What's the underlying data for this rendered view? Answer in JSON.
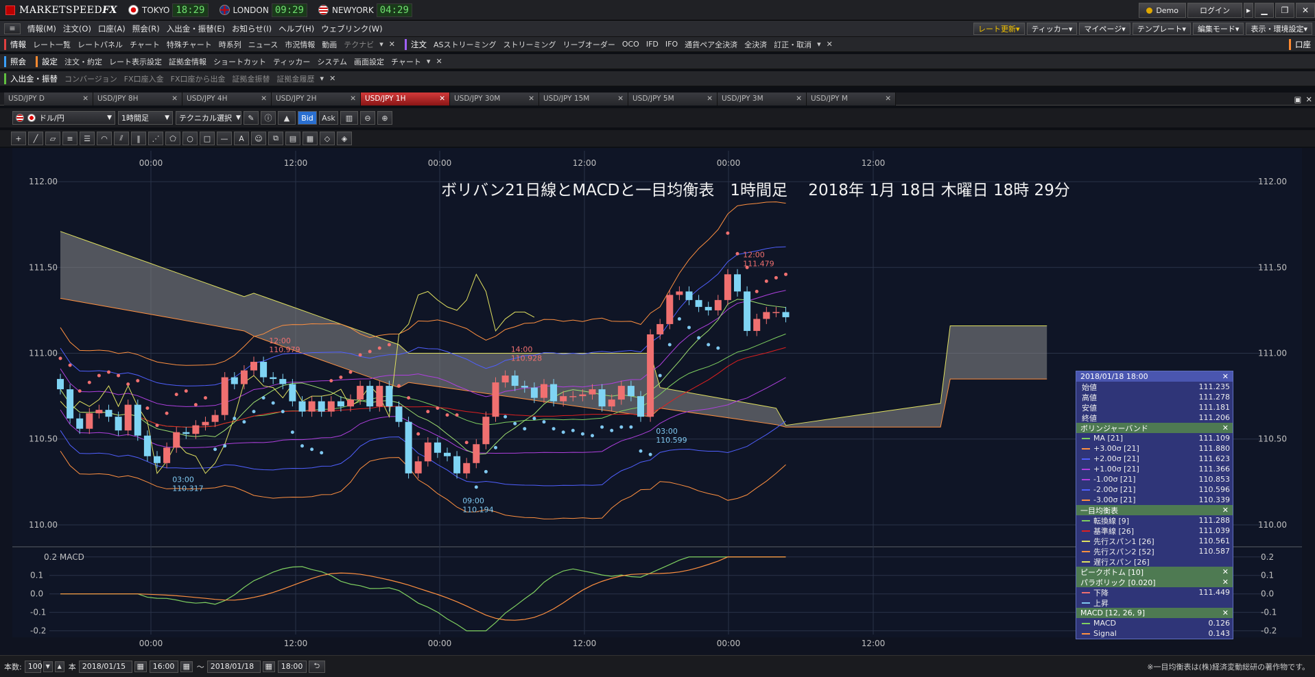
{
  "app": {
    "name_main": "MARKETSPEED",
    "name_suffix": " FX"
  },
  "clocks": [
    {
      "city": "TOKYO",
      "time": "18:29",
      "flag": "jp"
    },
    {
      "city": "LONDON",
      "time": "09:29",
      "flag": "uk"
    },
    {
      "city": "NEWYORK",
      "time": "04:29",
      "flag": "us"
    }
  ],
  "titlebar": {
    "demo": "Demo",
    "login": "ログイン"
  },
  "menu": [
    "情報(M)",
    "注文(O)",
    "口座(A)",
    "照会(R)",
    "入出金・振替(E)",
    "お知らせ(I)",
    "ヘルプ(H)",
    "ウェブリンク(W)"
  ],
  "menu_right": [
    "レート更新▾",
    "ティッカー▾",
    "マイページ▾",
    "テンプレート▾",
    "編集モード▾",
    "表示・環境設定▾"
  ],
  "strip1": {
    "sect_info": "情報",
    "info_items": [
      "レート一覧",
      "レートパネル",
      "チャート",
      "特殊チャート",
      "時系列",
      "ニュース",
      "市況情報",
      "動画",
      "テクナビ"
    ],
    "sect_order": "注文",
    "order_items": [
      "ASストリーミング",
      "ストリーミング",
      "リーブオーダー",
      "OCO",
      "IFD",
      "IFO",
      "通貨ペア全決済",
      "全決済",
      "訂正・取消"
    ],
    "account": "口座"
  },
  "strip2": {
    "sect_query": "照会",
    "sect_settings": "設定",
    "settings_items": [
      "注文・約定",
      "レート表示設定",
      "証拠金情報",
      "ショートカット",
      "ティッカー",
      "システム",
      "画面設定",
      "チャート"
    ]
  },
  "strip3": {
    "sect": "入出金・振替",
    "items": [
      "コンバージョン",
      "FX口座入金",
      "FX口座から出金",
      "証拠金振替",
      "証拠金履歴"
    ]
  },
  "tabs": [
    "USD/JPY D",
    "USD/JPY 8H",
    "USD/JPY 4H",
    "USD/JPY 2H",
    "USD/JPY 1H",
    "USD/JPY 30M",
    "USD/JPY 15M",
    "USD/JPY 5M",
    "USD/JPY 3M",
    "USD/JPY M"
  ],
  "active_tab": 4,
  "toolbar": {
    "pair": "ドル/円",
    "interval": "1時間足",
    "technical": "テクニカル選択",
    "bid": "Bid",
    "ask": "Ask"
  },
  "chart_title": "ボリバン21日線とMACDと一目均衡表　1時間足　 2018年 1月 18日 木曜日 18時 29分",
  "chart_data": {
    "type": "candlestick",
    "price_axis": {
      "ticks": [
        "112.00",
        "111.50",
        "111.00",
        "110.50",
        "110.00"
      ],
      "range": [
        109.88,
        112.18
      ]
    },
    "time_labels": [
      "00:00",
      "12:00",
      "00:00",
      "12:00",
      "00:00",
      "12:00"
    ],
    "macd_axis": {
      "ticks": [
        "0.2",
        "0.1",
        "0.0",
        "-0.1",
        "-0.2"
      ],
      "range": [
        -0.22,
        0.24
      ]
    },
    "macd_label": "MACD",
    "candles": [
      [
        110.85,
        110.79
      ],
      [
        110.79,
        110.62
      ],
      [
        110.62,
        110.56
      ],
      [
        110.56,
        110.65
      ],
      [
        110.65,
        110.67
      ],
      [
        110.67,
        110.63
      ],
      [
        110.63,
        110.55
      ],
      [
        110.55,
        110.7
      ],
      [
        110.7,
        110.52
      ],
      [
        110.52,
        110.4
      ],
      [
        110.4,
        110.36
      ],
      [
        110.36,
        110.45
      ],
      [
        110.45,
        110.54
      ],
      [
        110.54,
        110.53
      ],
      [
        110.53,
        110.58
      ],
      [
        110.58,
        110.6
      ],
      [
        110.6,
        110.64
      ],
      [
        110.64,
        110.86
      ],
      [
        110.86,
        110.82
      ],
      [
        110.82,
        110.9
      ],
      [
        110.9,
        110.95
      ],
      [
        110.95,
        110.86
      ],
      [
        110.86,
        110.85
      ],
      [
        110.85,
        110.82
      ],
      [
        110.82,
        110.72
      ],
      [
        110.72,
        110.66
      ],
      [
        110.66,
        110.72
      ],
      [
        110.72,
        110.66
      ],
      [
        110.66,
        110.72
      ],
      [
        110.72,
        110.69
      ],
      [
        110.69,
        110.73
      ],
      [
        110.73,
        110.81
      ],
      [
        110.81,
        110.69
      ],
      [
        110.69,
        110.81
      ],
      [
        110.81,
        110.69
      ],
      [
        110.69,
        110.6
      ],
      [
        110.6,
        110.3
      ],
      [
        110.3,
        110.37
      ],
      [
        110.37,
        110.48
      ],
      [
        110.48,
        110.42
      ],
      [
        110.42,
        110.4
      ],
      [
        110.4,
        110.3
      ],
      [
        110.3,
        110.36
      ],
      [
        110.36,
        110.47
      ],
      [
        110.47,
        110.63
      ],
      [
        110.63,
        110.83
      ],
      [
        110.83,
        110.87
      ],
      [
        110.87,
        110.81
      ],
      [
        110.81,
        110.8
      ],
      [
        110.8,
        110.74
      ],
      [
        110.74,
        110.82
      ],
      [
        110.82,
        110.72
      ],
      [
        110.72,
        110.75
      ],
      [
        110.75,
        110.75
      ],
      [
        110.75,
        110.76
      ],
      [
        110.76,
        110.79
      ],
      [
        110.79,
        110.69
      ],
      [
        110.69,
        110.73
      ],
      [
        110.73,
        110.81
      ],
      [
        110.81,
        110.75
      ],
      [
        110.75,
        110.63
      ],
      [
        110.63,
        111.11
      ],
      [
        111.11,
        111.17
      ],
      [
        111.17,
        111.34
      ],
      [
        111.34,
        111.36
      ],
      [
        111.36,
        111.31
      ],
      [
        111.31,
        111.27
      ],
      [
        111.27,
        111.25
      ],
      [
        111.25,
        111.31
      ],
      [
        111.31,
        111.46
      ],
      [
        111.46,
        111.36
      ],
      [
        111.36,
        111.13
      ],
      [
        111.13,
        111.2
      ],
      [
        111.2,
        111.24
      ],
      [
        111.24,
        111.24
      ],
      [
        111.24,
        111.21
      ]
    ],
    "annotations": [
      {
        "time": "03:00",
        "price": "110.317",
        "color": "#7fc8f0"
      },
      {
        "time": "12:00",
        "price": "110.979",
        "color": "#f07070"
      },
      {
        "time": "09:00",
        "price": "110.194",
        "color": "#7fc8f0"
      },
      {
        "time": "14:00",
        "price": "110.928",
        "color": "#f07070"
      },
      {
        "time": "03:00",
        "price": "110.599",
        "color": "#7fc8f0"
      },
      {
        "time": "12:00",
        "price": "111.479",
        "color": "#f07070"
      }
    ],
    "up_color": "#f07070",
    "down_color": "#7fd4f4"
  },
  "info_panel": {
    "header": "2018/01/18 18:00",
    "ohlc": [
      {
        "k": "始値",
        "v": "111.235"
      },
      {
        "k": "高値",
        "v": "111.278"
      },
      {
        "k": "安値",
        "v": "111.181"
      },
      {
        "k": "終値",
        "v": "111.206"
      }
    ],
    "bb_title": "ボリンジャーバンド",
    "bb": [
      {
        "k": "MA [21]",
        "v": "111.109",
        "c": "#7fd060"
      },
      {
        "k": "+3.00σ [21]",
        "v": "111.880",
        "c": "#ff9040"
      },
      {
        "k": "+2.00σ [21]",
        "v": "111.623",
        "c": "#5060ff"
      },
      {
        "k": "+1.00σ [21]",
        "v": "111.366",
        "c": "#b040e0"
      },
      {
        "k": "-1.00σ [21]",
        "v": "110.853",
        "c": "#b040e0"
      },
      {
        "k": "-2.00σ [21]",
        "v": "110.596",
        "c": "#5060ff"
      },
      {
        "k": "-3.00σ [21]",
        "v": "110.339",
        "c": "#ff9040"
      }
    ],
    "ichi_title": "一目均衡表",
    "ichi": [
      {
        "k": "転換線 [9]",
        "v": "111.288",
        "c": "#7fd060"
      },
      {
        "k": "基準線 [26]",
        "v": "111.039",
        "c": "#e02020"
      },
      {
        "k": "先行スパン1 [26]",
        "v": "110.561",
        "c": "#e0e060"
      },
      {
        "k": "先行スパン2 [52]",
        "v": "110.587",
        "c": "#ff9040"
      },
      {
        "k": "遅行スパン [26]",
        "v": "",
        "c": "#e0e060"
      }
    ],
    "peak_title": "ピークボトム [10]",
    "para_title": "パラボリック [0.020]",
    "para": [
      {
        "k": "下降",
        "v": "111.449",
        "c": "#f07070"
      },
      {
        "k": "上昇",
        "v": "",
        "c": "#7fc8f0"
      }
    ],
    "macd_title": "MACD [12, 26, 9]",
    "macd": [
      {
        "k": "MACD",
        "v": "0.126",
        "c": "#7fd060"
      },
      {
        "k": "Signal",
        "v": "0.143",
        "c": "#ff9040"
      }
    ]
  },
  "status": {
    "count_label": "本数:",
    "count": "100",
    "unit": "本",
    "from_date": "2018/01/15",
    "from_time": "16:00",
    "to_date": "2018/01/18",
    "to_time": "18:00",
    "note": "※一目均衡表は(株)経済変動総研の著作物です。"
  }
}
